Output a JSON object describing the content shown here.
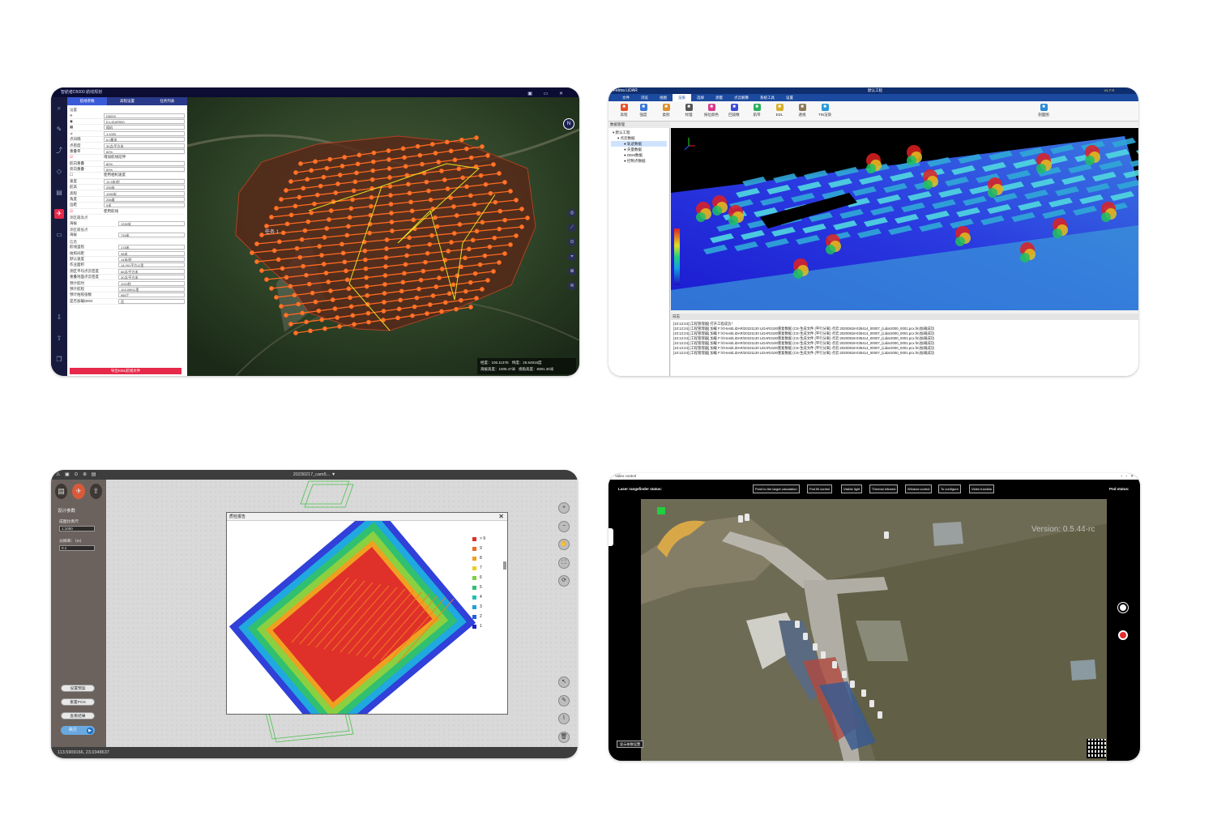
{
  "panel1": {
    "title": "智航者D5000 航线规划",
    "tabs": [
      "航线参数",
      "高程设置",
      "任务列表"
    ],
    "form": {
      "section": "设置",
      "drone": "D5000",
      "payload": "D-LIDAR550",
      "mode": "相机",
      "scale": "1:1000",
      "rows": [
        {
          "label": "点间隔",
          "value": "6.0厘米"
        },
        {
          "label": "点密度",
          "value": "30点/平方米"
        },
        {
          "label": "重叠率",
          "value": "60%"
        }
      ],
      "check1": "增加航线延伸",
      "rows2": [
        {
          "label": "航向重叠",
          "value": "80%"
        },
        {
          "label": "旁向重叠",
          "value": "60%"
        }
      ],
      "check2": "使用相机速度",
      "rows3": [
        {
          "label": "速度",
          "value": "12.5米/秒"
        },
        {
          "label": "航高",
          "value": "255米"
        },
        {
          "label": "高程",
          "value": "1050米"
        },
        {
          "label": "角度",
          "value": "256度"
        },
        {
          "label": "边距",
          "value": "0米"
        }
      ],
      "check3": "使用航线",
      "results_title1": "测区最高点",
      "results_title2": "测区最低点",
      "results_title3": "信息",
      "results": [
        {
          "label": "海拔",
          "value": "1330米"
        },
        {
          "label": "海拔",
          "value": "739米"
        },
        {
          "label": "航线里程",
          "value": "178米"
        },
        {
          "label": "拍照间距",
          "value": "98米"
        },
        {
          "label": "默认速度",
          "value": "14米/秒"
        },
        {
          "label": "作业面积",
          "value": "14.091平方公里"
        },
        {
          "label": "测区平均点云密度",
          "value": "66点/平方米"
        },
        {
          "label": "重叠地面点云密度",
          "value": "30点/平方米"
        },
        {
          "label": "预计航时",
          "value": "1010秒"
        },
        {
          "label": "预计航程",
          "value": "103.055公里"
        },
        {
          "label": "预计拍照张数",
          "value": "985个"
        },
        {
          "label": "是否加载DEM",
          "value": "否"
        }
      ],
      "export_label": "导出KML航线文件"
    },
    "map": {
      "task_label": "任务 1",
      "compass": "N",
      "coords": {
        "lon": "经度：106.1137E",
        "lat": "纬度：25.54816度",
        "alt": "海拔高度：1005.47米",
        "view": "视角高度：8391.30米"
      }
    }
  },
  "panel2": {
    "app_title": "Feima LiDAR",
    "window_title": "默认工程",
    "version": "v1.7.0",
    "menu": [
      "文件",
      "浏览",
      "视图",
      "渲染",
      "选择",
      "测量",
      "点云解算",
      "系统工具",
      "设置"
    ],
    "active_menu": "渲染",
    "ribbon": [
      {
        "label": "高程",
        "color": "#e8502a"
      },
      {
        "label": "强度",
        "color": "#3a78d8"
      },
      {
        "label": "类别",
        "color": "#e0902a"
      },
      {
        "label": "纹理",
        "color": "#555555"
      },
      {
        "label": "按位颜色",
        "color": "#d83a8a"
      },
      {
        "label": "回波数",
        "color": "#3a4ad8"
      },
      {
        "label": "航带",
        "color": "#2ab05a"
      },
      {
        "label": "EDL",
        "color": "#d8b02a"
      },
      {
        "label": "透视",
        "color": "#8a7a5a"
      },
      {
        "label": "TIN渲染",
        "color": "#2a9ad8"
      },
      {
        "label": "剖面图",
        "color": "#2a8ad8"
      }
    ],
    "tree_header": "数据管理",
    "tree": [
      "默认工程",
      "点云数据",
      "轨迹数据",
      "矢量数据",
      "DEM数据",
      "控制点数据"
    ],
    "log_header": "日志",
    "log": [
      "[10:13:24] [工程管理器] 打开工程成功！",
      "[10:13:24] [工程管理器] 加载 F:\\/0-test/LiDAR/20221130 LiDAR2100重复数据 (CS-生成文件  (平行分离)  点云:20200818-035414_00007_(Lidar2000_0001.pcx.fm)加载成功",
      "[10:13:24] [工程管理器] 加载 F:\\/0-test/LiDAR/20221130 LiDAR2100重复数据 (CS-生成文件  (平行分离)  点云:20200818-035414_00007_(Lidar2000_0001.pcx.fm)加载成功",
      "[10:13:24] [工程管理器] 加载 F:\\/0-test/LiDAR/20221130 LiDAR2100重复数据 (CS-生成文件  (平行分离)  点云:20200818-035414_00007_(Lidar2000_0001.pcx.fm)加载成功",
      "[10:13:24] [工程管理器] 加载 F:\\/0-test/LiDAR/20221130 LiDAR2100重复数据 (CS-生成文件  (平行分离)  点云:20200818-035414_00007_(Lidar2000_0001.pcx.fm)加载成功",
      "[10:13:24] [工程管理器] 加载 F:\\/0-test/LiDAR/20221130 LiDAR2100重复数据 (CS-生成文件  (平行分离)  点云:20200818-035414_00007_(Lidar2000_0001.pcx.fm)加载成功",
      "[10:13:24] [工程管理器] 加载 F:\\/0-test/LiDAR/20221130 LiDAR2100重复数据 (CS-生成文件  (平行分离)  点云:20200818-035414_00007_(Lidar2000_0001.pcx.fm)加载成功"
    ]
  },
  "panel3": {
    "title": "20230217_cam5...",
    "section": "设计参数",
    "scale_label": "成图比例尺",
    "scale_value": "1:1000",
    "res_label": "分辨率：（m）",
    "res_value": "0.1",
    "buttons": [
      "设置预案",
      "重置POS",
      "查看结果"
    ],
    "run_label": "执行",
    "dialog_title": "质检报告",
    "legend": [
      {
        "label": "> 9",
        "color": "#e0302a"
      },
      {
        "label": "9",
        "color": "#f06a20"
      },
      {
        "label": "8",
        "color": "#f0a020"
      },
      {
        "label": "7",
        "color": "#e8d020"
      },
      {
        "label": "6",
        "color": "#7ad040"
      },
      {
        "label": "5",
        "color": "#30c070"
      },
      {
        "label": "4",
        "color": "#20c0b0"
      },
      {
        "label": "3",
        "color": "#20a0d8"
      },
      {
        "label": "2",
        "color": "#2060e0"
      },
      {
        "label": "1",
        "color": "#2020c0"
      }
    ],
    "coords": "113.5909166, 23.0348637"
  },
  "panel4": {
    "window_title": "Video control",
    "laser_label": "Laser rangefinder status:",
    "pod_label": "Pod status:",
    "buttons": [
      "Point to the target calculation",
      "Pod fill control",
      "Visible light",
      "Thermal infrared",
      "Window control",
      "To configure",
      "Video function"
    ],
    "version": "Version: 0.5.44-rc",
    "show_label": "显示参数设置"
  }
}
